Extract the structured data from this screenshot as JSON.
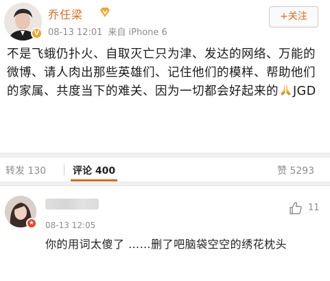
{
  "post": {
    "username": "乔任梁",
    "timestamp": "08-13 12:01",
    "source": "来自 iPhone 6",
    "follow_label": "+关注",
    "text_main": "不是飞蛾仍扑火、自取灭亡只为津、发达的网络、万能的微博、请人肉出那些英雄们、记住他们的模样、帮助他们的家属、共度当下的难关、因为一切都会好起来的",
    "text_tail": "JGD"
  },
  "tabs": {
    "reposts_label": "转发 130",
    "comments_label": "评论 400",
    "likes_label": "赞 5293"
  },
  "comment": {
    "timestamp": "08-13 12:05",
    "like_count": "11",
    "text": "你的用词太傻了 ……删了吧脑袋空空的绣花枕头"
  },
  "colors": {
    "accent": "#e0671c",
    "meta_gray": "#8c8c8c",
    "divider": "#efefef"
  },
  "icons": [
    "verified-badge-icon",
    "praying-hands-icon",
    "thumbs-up-icon",
    "vip-badge-icon"
  ]
}
